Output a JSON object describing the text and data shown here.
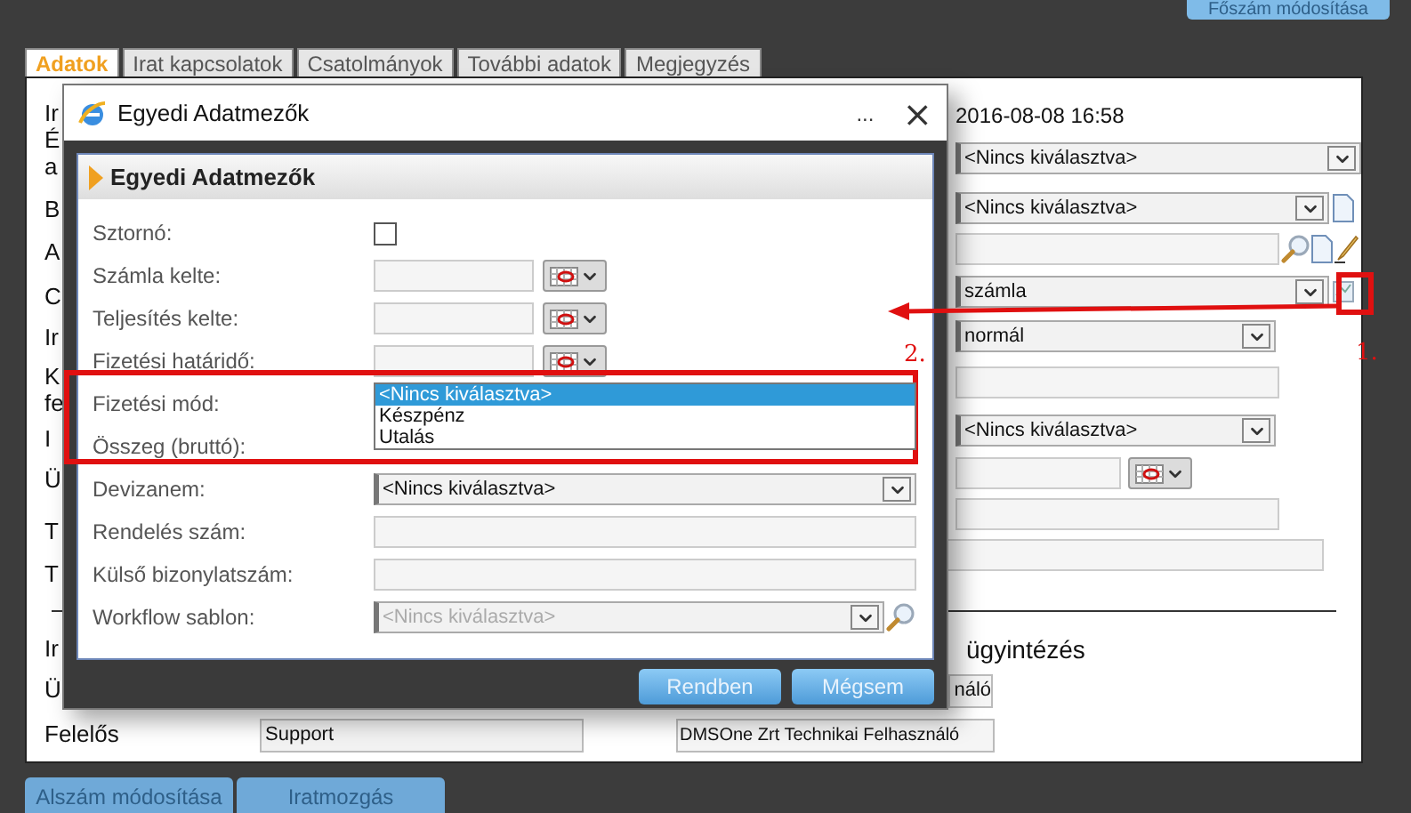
{
  "top_button": "Főszám módosítása",
  "tabs": [
    {
      "label": "Adatok",
      "selected": true
    },
    {
      "label": "Irat kapcsolatok",
      "selected": false
    },
    {
      "label": "Csatolmányok",
      "selected": false
    },
    {
      "label": "További adatok",
      "selected": false
    },
    {
      "label": "Megjegyzés",
      "selected": false
    }
  ],
  "form": {
    "label_fragments": [
      "Ir",
      "É",
      "a",
      "B",
      "A",
      "C",
      "Ir",
      "K",
      "fe",
      "I",
      "Ü",
      "T",
      "T"
    ],
    "fields": [
      {
        "kind": "text",
        "value": "2016-08-08 16:58"
      },
      {
        "kind": "select",
        "value": "<Nincs kiválasztva>"
      },
      {
        "kind": "select-doc",
        "value": "<Nincs kiválasztva>"
      },
      {
        "kind": "lookup"
      },
      {
        "kind": "select-flag",
        "value": "számla"
      },
      {
        "kind": "select-short",
        "value": "normál"
      },
      {
        "kind": "input"
      },
      {
        "kind": "select-short",
        "value": "<Nincs kiválasztva>"
      },
      {
        "kind": "date"
      },
      {
        "kind": "input"
      },
      {
        "kind": "input-wide"
      }
    ]
  },
  "lower": {
    "fragments": [
      "Ir",
      "Ü"
    ],
    "owner_label": "Felelős",
    "section_title": "ügyintézés",
    "assignee_fragment": "náló",
    "owner": "Support",
    "technical_user": "DMSOne Zrt Technikai Felhasználó"
  },
  "bottom_buttons": [
    "Alszám módosítása",
    "Iratmozgás"
  ],
  "dialog": {
    "title": "Egyedi Adatmezők",
    "menu": "...",
    "close": "×",
    "header": "Egyedi Adatmezők",
    "rows": [
      {
        "label": "Sztornó:",
        "kind": "checkbox",
        "checked": false
      },
      {
        "label": "Számla kelte:",
        "kind": "date"
      },
      {
        "label": "Teljesítés kelte:",
        "kind": "date"
      },
      {
        "label": "Fizetési határidő:",
        "kind": "date"
      },
      {
        "label": "Fizetési mód:",
        "kind": "dropdown",
        "options": [
          {
            "label": "<Nincs kiválasztva>",
            "selected": true
          },
          {
            "label": "Készpénz",
            "selected": false
          },
          {
            "label": "Utalás",
            "selected": false
          }
        ]
      },
      {
        "label": "Összeg (bruttó):",
        "kind": "covered"
      },
      {
        "label": "Devizanem:",
        "kind": "select",
        "value": "<Nincs kiválasztva>",
        "disabled": false
      },
      {
        "label": "Rendelés szám:",
        "kind": "input"
      },
      {
        "label": "Külső bizonylatszám:",
        "kind": "input"
      },
      {
        "label": "Workflow sablon:",
        "kind": "select-lookup",
        "value": "<Nincs kiválasztva>",
        "disabled": true
      }
    ],
    "buttons": [
      "Rendben",
      "Mégsem"
    ]
  },
  "annotations": [
    "2.",
    "1."
  ]
}
